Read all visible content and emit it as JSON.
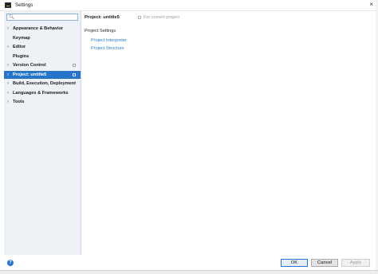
{
  "window": {
    "title": "Settings",
    "close_glyph": "×"
  },
  "search": {
    "placeholder": "",
    "value": "",
    "icon": "search-icon"
  },
  "sidebar": {
    "items": [
      {
        "label": "Appearance & Behavior",
        "expandable": true,
        "selected": false,
        "copy_icon": false
      },
      {
        "label": "Keymap",
        "expandable": false,
        "selected": false,
        "copy_icon": false
      },
      {
        "label": "Editor",
        "expandable": true,
        "selected": false,
        "copy_icon": false
      },
      {
        "label": "Plugins",
        "expandable": false,
        "selected": false,
        "copy_icon": false
      },
      {
        "label": "Version Control",
        "expandable": true,
        "selected": false,
        "copy_icon": true
      },
      {
        "label": "Project: untitle5",
        "expandable": true,
        "selected": true,
        "copy_icon": true
      },
      {
        "label": "Build, Execution, Deployment",
        "expandable": true,
        "selected": false,
        "copy_icon": false
      },
      {
        "label": "Languages & Frameworks",
        "expandable": true,
        "selected": false,
        "copy_icon": false
      },
      {
        "label": "Tools",
        "expandable": true,
        "selected": false,
        "copy_icon": false
      }
    ],
    "chevron_glyph": "›",
    "help_glyph": "?"
  },
  "content": {
    "title": "Project: untitle5",
    "for_current_project": "For current project",
    "section_title": "Project Settings",
    "links": [
      {
        "label": "Project Interpreter"
      },
      {
        "label": "Project Structure"
      }
    ]
  },
  "buttons": {
    "ok": "OK",
    "cancel": "Cancel",
    "apply": "Apply"
  },
  "colors": {
    "selection": "#2675c9",
    "link": "#2f7cc9",
    "sidebar_bg": "#eef1f6"
  }
}
